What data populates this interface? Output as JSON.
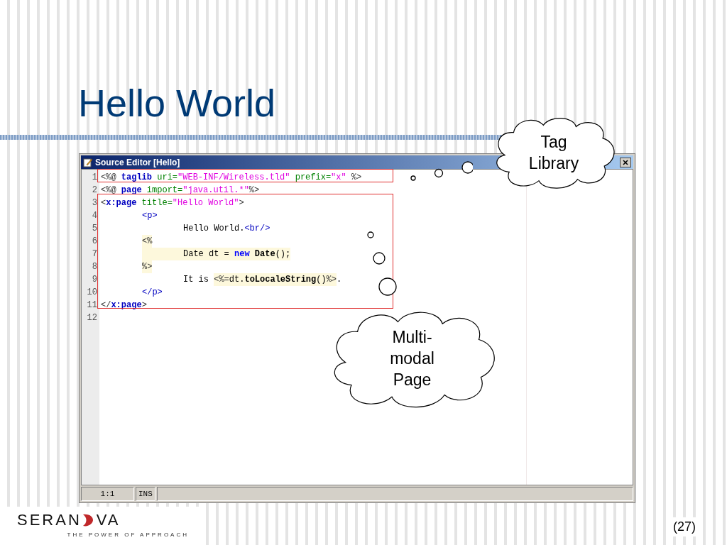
{
  "slide_title": "Hello World",
  "editor": {
    "title": "Source Editor [Hello]",
    "lines": [
      {
        "number": "1",
        "tokens": [
          {
            "kind": "delim",
            "text": "<%@ "
          },
          {
            "kind": "keyword",
            "text": "taglib"
          },
          {
            "kind": "attr",
            "text": " uri="
          },
          {
            "kind": "string",
            "text": "\"WEB-INF/Wireless.tld\""
          },
          {
            "kind": "attr",
            "text": " prefix="
          },
          {
            "kind": "string",
            "text": "\"x\""
          },
          {
            "kind": "delim",
            "text": " %>"
          }
        ]
      },
      {
        "number": "2",
        "tokens": [
          {
            "kind": "delim",
            "text": "<%@ "
          },
          {
            "kind": "keyword",
            "text": "page"
          },
          {
            "kind": "attr",
            "text": " import="
          },
          {
            "kind": "string",
            "text": "\"java.util.*\""
          },
          {
            "kind": "delim",
            "text": "%>"
          }
        ]
      },
      {
        "number": "3",
        "tokens": [
          {
            "kind": "delim",
            "text": "<"
          },
          {
            "kind": "keyword",
            "text": "x:page"
          },
          {
            "kind": "attr",
            "text": " title="
          },
          {
            "kind": "string",
            "text": "\"Hello World\""
          },
          {
            "kind": "delim",
            "text": ">"
          }
        ]
      },
      {
        "number": "4",
        "kind": "indented",
        "tokens": [
          {
            "kind": "tag",
            "text": "<p>"
          }
        ]
      },
      {
        "number": "5",
        "kind": "nested",
        "tokens": [
          {
            "kind": "text",
            "text": "Hello World."
          },
          {
            "kind": "tag",
            "text": "<br/>"
          }
        ]
      },
      {
        "number": "6",
        "kind": "indented",
        "tokens": [
          {
            "kind": "sdelim",
            "text": "<%"
          }
        ]
      },
      {
        "number": "7",
        "kind": "scriptlet",
        "tokens": [
          {
            "kind": "stext",
            "text": "Date dt = "
          },
          {
            "kind": "skeyword",
            "text": "new "
          },
          {
            "kind": "smethod",
            "text": "Date"
          },
          {
            "kind": "stext",
            "text": "();"
          }
        ]
      },
      {
        "number": "8",
        "kind": "indented",
        "tokens": [
          {
            "kind": "sdelim",
            "text": "%>"
          }
        ]
      },
      {
        "number": "9",
        "kind": "nested",
        "tokens": [
          {
            "kind": "text",
            "text": "It is "
          },
          {
            "kind": "sdelim",
            "text": "<%="
          },
          {
            "kind": "stext",
            "text": "dt."
          },
          {
            "kind": "smethod",
            "text": "toLocaleString"
          },
          {
            "kind": "stext",
            "text": "()"
          },
          {
            "kind": "sdelim",
            "text": "%>"
          },
          {
            "kind": "text",
            "text": "."
          }
        ]
      },
      {
        "number": "10",
        "kind": "indented",
        "tokens": [
          {
            "kind": "tag",
            "text": "</p>"
          }
        ]
      },
      {
        "number": "11",
        "tokens": [
          {
            "kind": "delim",
            "text": "</"
          },
          {
            "kind": "keyword",
            "text": "x:page"
          },
          {
            "kind": "delim",
            "text": ">"
          }
        ]
      },
      {
        "number": "12"
      }
    ],
    "status_bar": [
      "1:1",
      "INS"
    ]
  },
  "callouts": [
    {
      "lines": [
        "Tag",
        "Library"
      ]
    },
    {
      "lines": [
        "Multi-",
        "modal",
        "Page"
      ]
    }
  ],
  "logo": {
    "name_start": "SERAN",
    "name_end": "VA",
    "tagline": "THE POWER OF APPROACH"
  },
  "page_number": "(27)"
}
